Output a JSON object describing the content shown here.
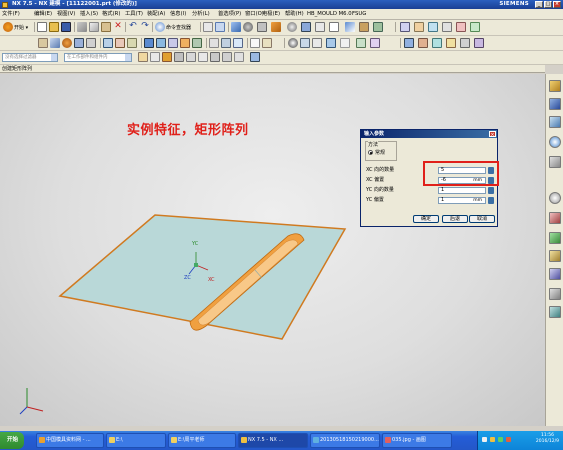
{
  "window": {
    "title": "NX 7.5 - NX 建模 - [11122001.prt (修改的)]",
    "brand": "SIEMENS"
  },
  "menu": {
    "items": [
      "文件(F)",
      "编辑(E)",
      "视图(V)",
      "插入(S)",
      "格式(R)",
      "工具(T)",
      "装配(A)",
      "信息(I)",
      "分析(L)",
      "首选项(P)",
      "窗口(O)",
      "电极(E)",
      "帮助(H)",
      "HB_MOULD M6.0",
      "FSUG"
    ]
  },
  "toolbar": {
    "start_label": "开始 ▾",
    "command_finder": "命令查找器"
  },
  "selection": {
    "filter_placeholder": "没有选择过滤器",
    "scope_placeholder": "在工作部件和组件内"
  },
  "cue": {
    "text": "创建矩形阵列"
  },
  "annotation": {
    "text": "实例特征，矩形阵列"
  },
  "axes": {
    "yc": "YC",
    "zc": "ZC",
    "xc": "XC"
  },
  "dialog": {
    "title": "输入参数",
    "group_label": "方法",
    "method": "常规",
    "fields": [
      {
        "label": "XC 向的数量",
        "value": "5",
        "unit": ""
      },
      {
        "label": "XC 偏置",
        "value": "-6",
        "unit": "mm"
      },
      {
        "label": "YC 向的数量",
        "value": "1",
        "unit": ""
      },
      {
        "label": "YC 偏置",
        "value": "1",
        "unit": "mm"
      }
    ],
    "buttons": {
      "ok": "确定",
      "back": "后退",
      "cancel": "取消"
    }
  },
  "taskbar": {
    "start": "开始",
    "items": [
      "中国模具资料网 - ...",
      "E:\\",
      "E:\\周平老师",
      "NX 7.5 - NX ...",
      "20130518150219000...",
      "035.jpg - 画图"
    ],
    "clock_time": "11:56",
    "clock_date": "2016/12/9"
  },
  "colors": {
    "accent": "#e0201a",
    "plate": "#b9d8d8",
    "rib": "#f0a040",
    "title_blue": "#1a3f94"
  }
}
